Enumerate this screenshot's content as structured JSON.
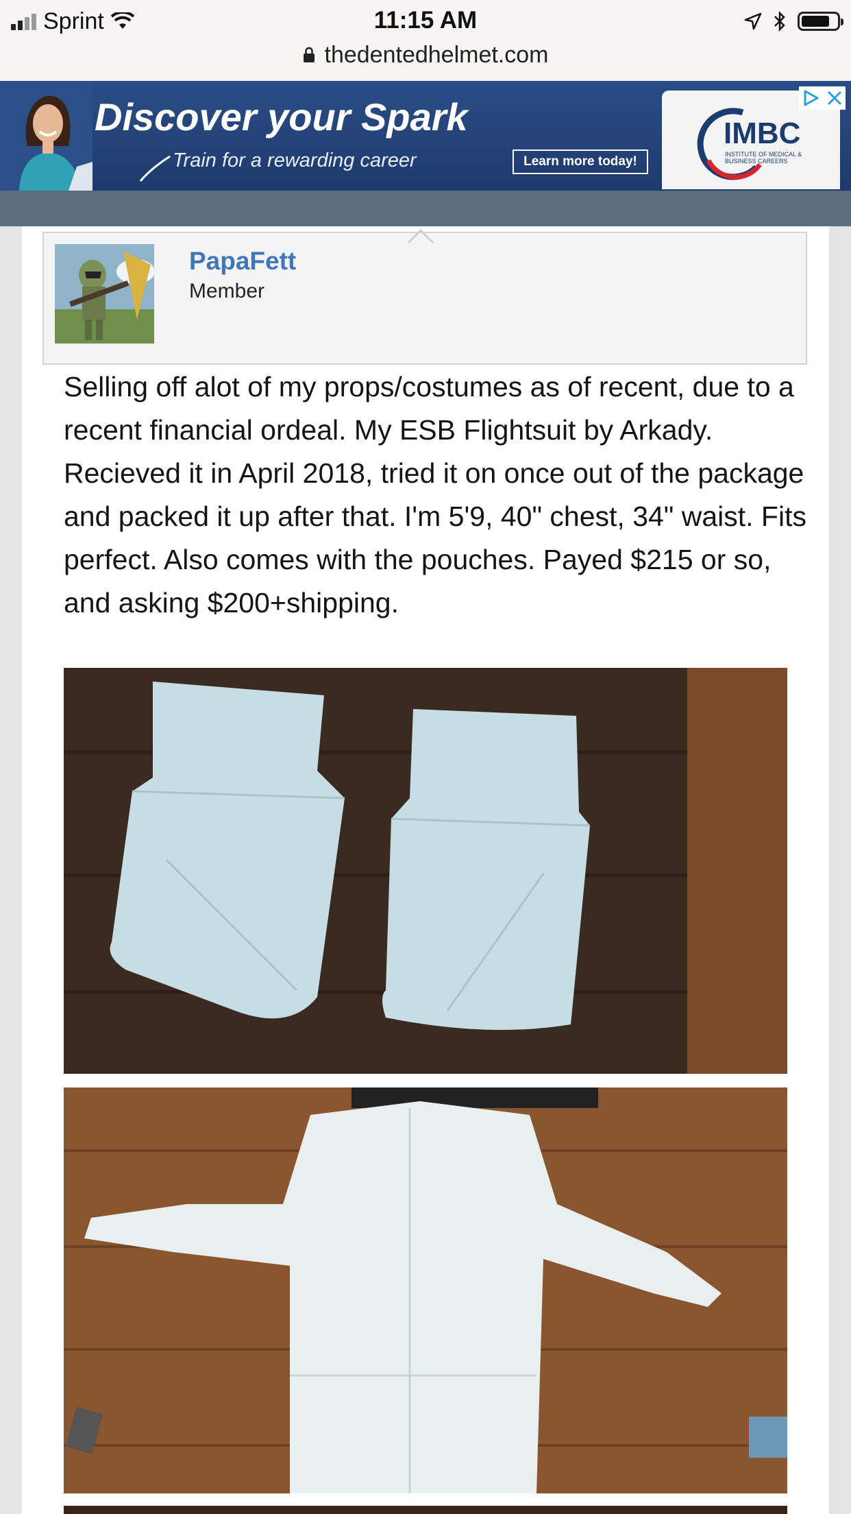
{
  "status_bar": {
    "carrier": "Sprint",
    "time": "11:15 AM",
    "icons": [
      "signal-bars-icon",
      "wifi-icon",
      "location-arrow-icon",
      "bluetooth-icon",
      "battery-icon"
    ],
    "battery_level": 0.8
  },
  "browser": {
    "url": "thedentedhelmet.com",
    "secure_icon": "lock-icon"
  },
  "ad": {
    "headline": "Discover your Spark",
    "subline": "Train for a rewarding career",
    "cta": "Learn more today!",
    "brand": "IMBC",
    "brand_tagline": "INSTITUTE OF MEDICAL & BUSINESS CAREERS",
    "adchoices_icon": "adchoices-icon",
    "close_icon": "close-icon",
    "colors": {
      "background": "#234479",
      "strip": "#5a6d7e"
    }
  },
  "post": {
    "username": "PapaFett",
    "user_title": "Member",
    "body": "Selling off alot of my props/costumes as of recent, due to a recent financial ordeal. My ESB Flightsuit by Arkady. Recieved it in April 2018, tried it on once out of the package and packed it up after that. I'm 5'9, 40\" chest, 34\" waist. Fits perfect. Also comes with the pouches. Payed $215 or so, and asking $200+shipping.",
    "colors": {
      "username": "#3f78b8"
    }
  }
}
